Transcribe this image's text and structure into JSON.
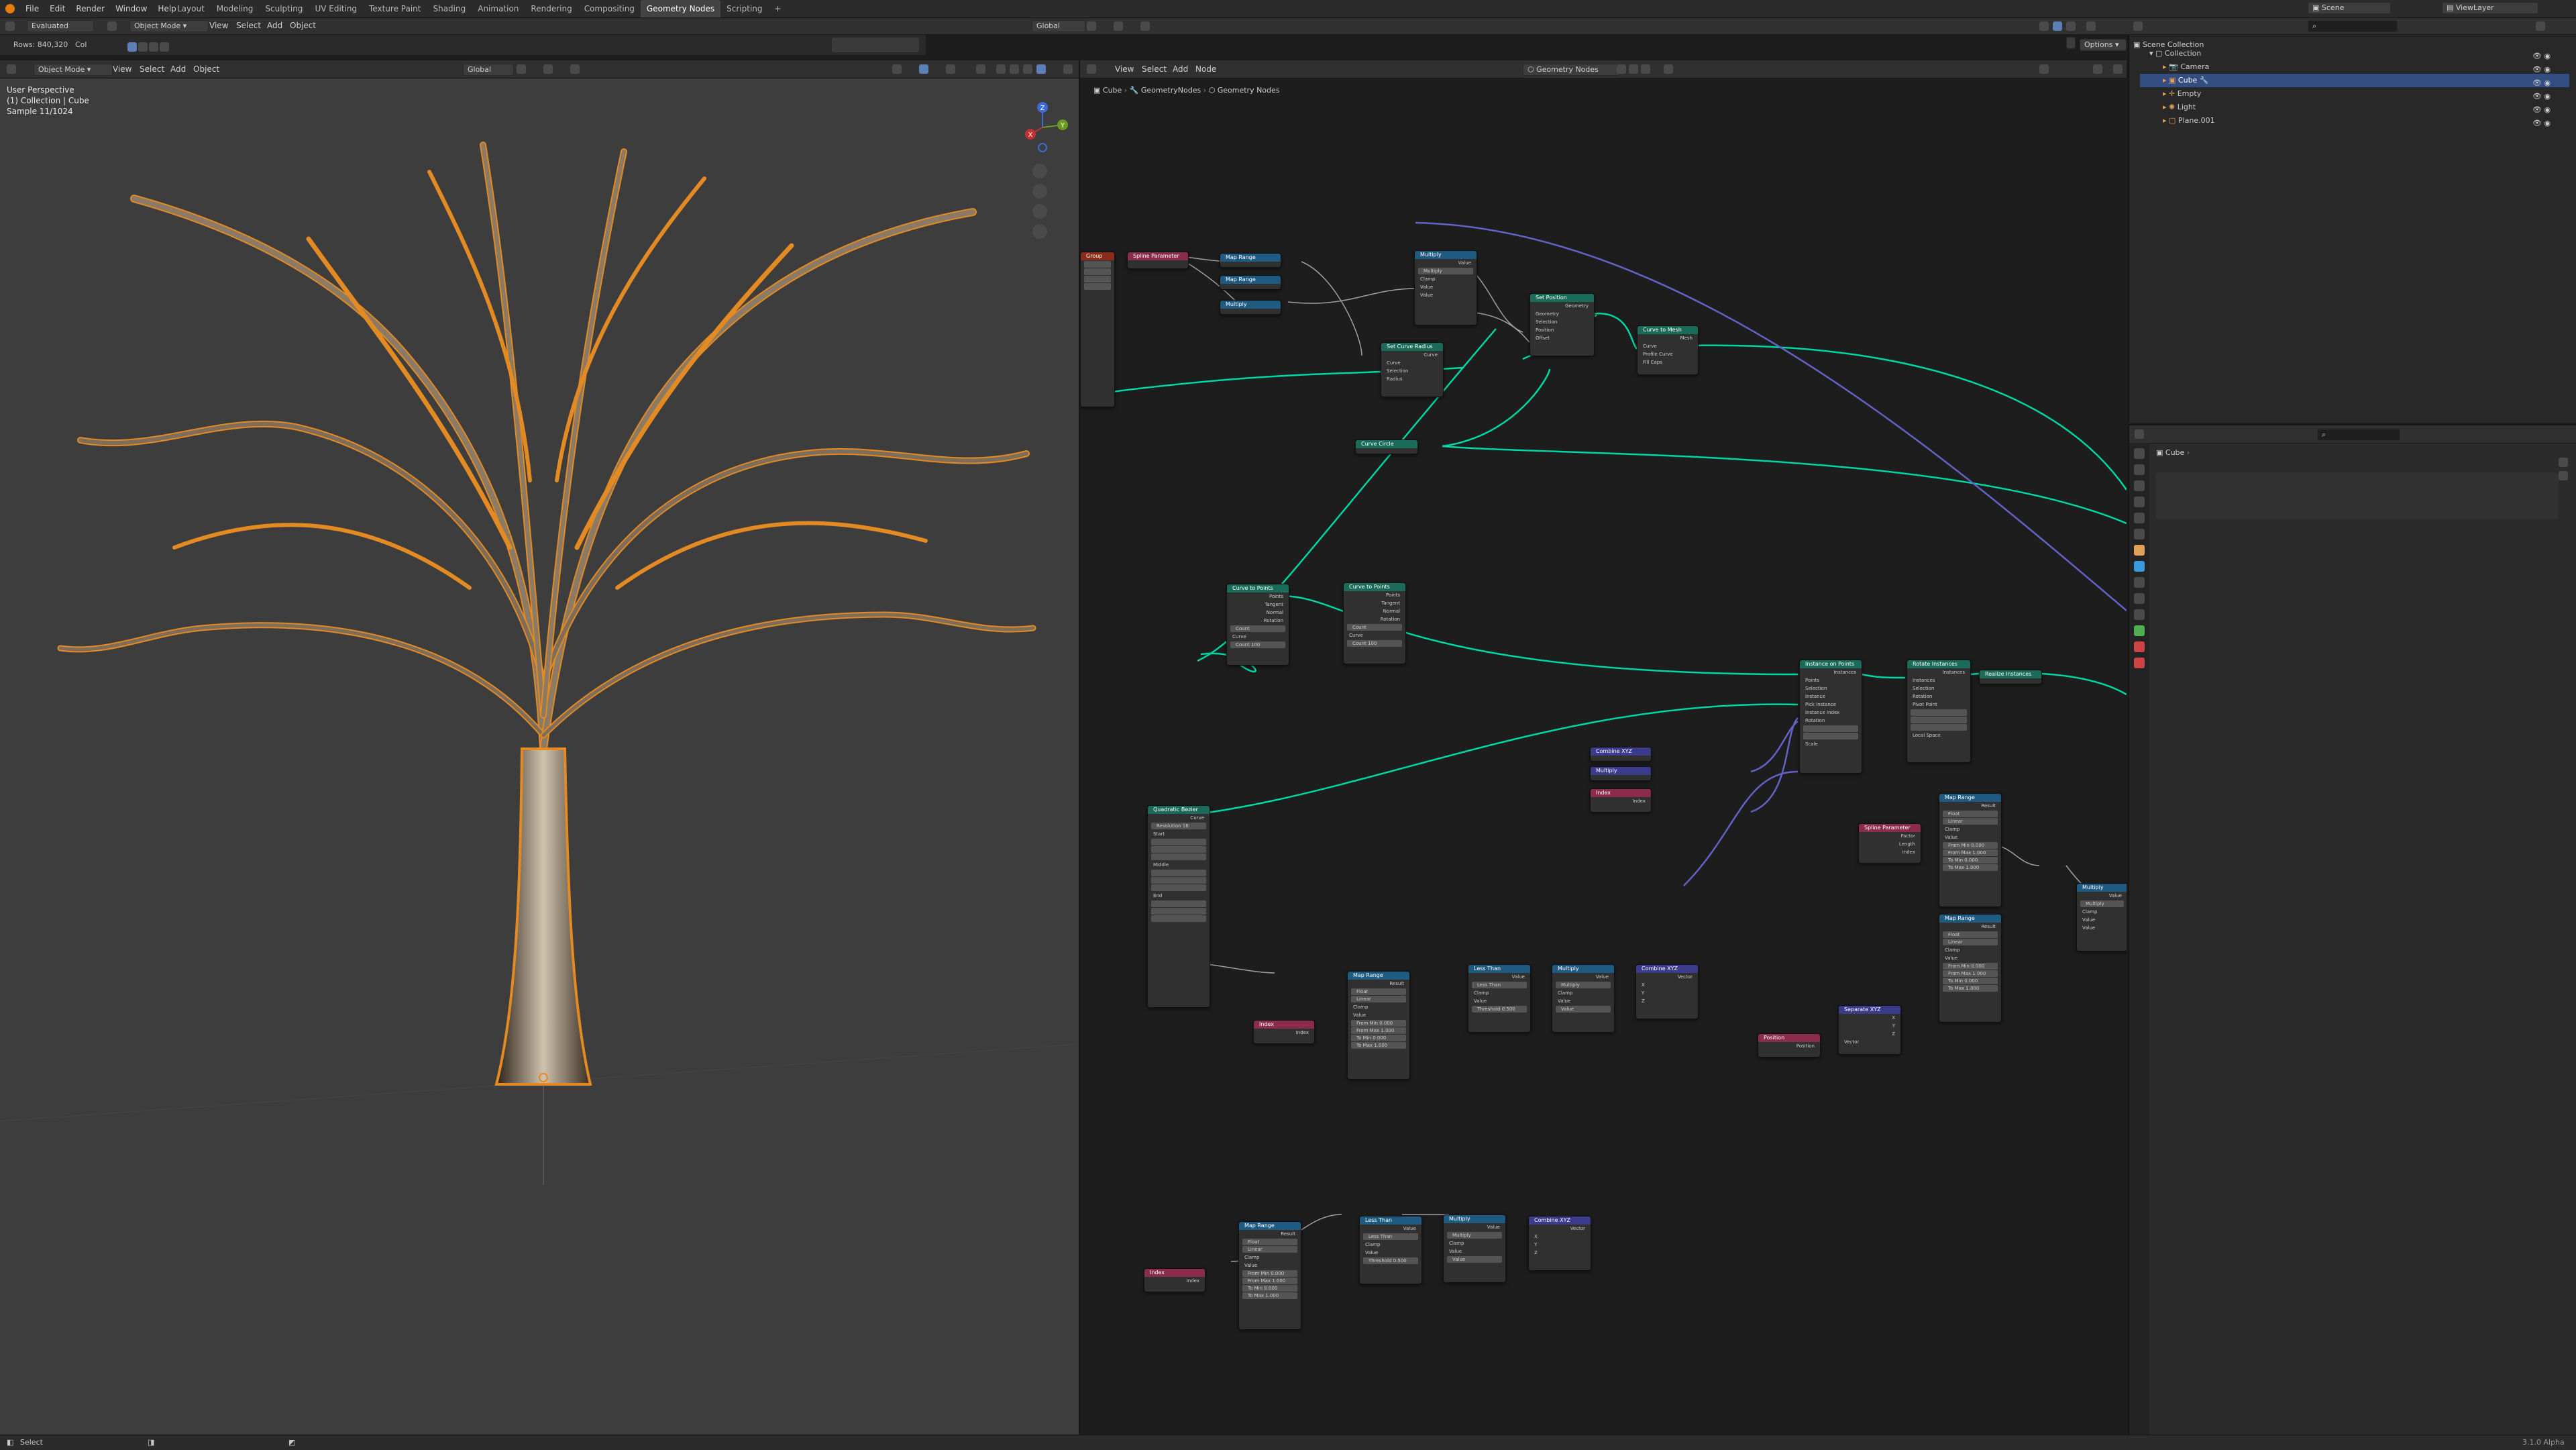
{
  "app": {
    "menu": [
      "File",
      "Edit",
      "Render",
      "Window",
      "Help"
    ],
    "workspaces": [
      "Layout",
      "Modeling",
      "Sculpting",
      "UV Editing",
      "Texture Paint",
      "Shading",
      "Animation",
      "Rendering",
      "Compositing",
      "Geometry Nodes",
      "Scripting"
    ],
    "active_workspace": "Geometry Nodes",
    "scene": "Scene",
    "view_layer": "ViewLayer",
    "global_transform": "Global",
    "options": "Options",
    "evaluated": "Evaluated",
    "rows": "Rows: 840,320",
    "col": "Col"
  },
  "viewport": {
    "mode": "Object Mode",
    "menu": [
      "View",
      "Select",
      "Add",
      "Object"
    ],
    "transform": "Global",
    "overlay_lines": [
      "User Perspective",
      "(1) Collection | Cube",
      "Sample 11/1024"
    ],
    "axes": {
      "x": "X",
      "y": "Y",
      "z": "Z"
    }
  },
  "node_editor": {
    "menu": [
      "View",
      "Select",
      "Add",
      "Node"
    ],
    "tree_name": "Geometry Nodes",
    "breadcrumb": [
      "Cube",
      "GeometryNodes",
      "Geometry Nodes"
    ]
  },
  "outliner": {
    "title": "Scene Collection",
    "items": [
      {
        "label": "Collection",
        "indent": 1,
        "selected": false
      },
      {
        "label": "Camera",
        "indent": 2,
        "selected": false
      },
      {
        "label": "Cube",
        "indent": 2,
        "selected": true
      },
      {
        "label": "Empty",
        "indent": 2,
        "selected": false
      },
      {
        "label": "Light",
        "indent": 2,
        "selected": false
      },
      {
        "label": "Plane.001",
        "indent": 2,
        "selected": false
      }
    ]
  },
  "properties": {
    "object": "Cube"
  },
  "statusbar": {
    "left": "Select",
    "right": "3.1.0 Alpha"
  },
  "colors": {
    "accent": "#e38a22",
    "selection": "#334d80",
    "geometry_link": "#00d6a3",
    "vector_link": "#6363c7"
  },
  "nodes": [
    {
      "title": "Spline Parameter",
      "color": "#8a2c4c",
      "rows": [
        "Factor",
        "Length",
        "Index"
      ]
    },
    {
      "title": "Map Range",
      "color": "#1f5a80",
      "rows": [
        "Result",
        "Float",
        "Linear",
        "Clamp",
        "Value",
        "From Min 0.000",
        "From Max 1.000",
        "To Min 0.000",
        "To Max 1.000"
      ]
    },
    {
      "title": "Multiply",
      "color": "#1f5a80",
      "rows": [
        "Value",
        "Multiply",
        "Clamp",
        "Value",
        "Value"
      ]
    },
    {
      "title": "Set Position",
      "color": "#1a6b59",
      "rows": [
        "Geometry",
        "Geometry",
        "Selection",
        "Position",
        "Offset"
      ]
    },
    {
      "title": "Curve to Mesh",
      "color": "#1a6b59",
      "rows": [
        "Mesh",
        "Curve",
        "Profile Curve",
        "Fill Caps"
      ]
    },
    {
      "title": "Set Curve Radius",
      "color": "#1a6b59",
      "rows": [
        "Curve",
        "Curve",
        "Selection",
        "Radius"
      ]
    },
    {
      "title": "Curve Circle",
      "color": "#1a6b59",
      "rows": [
        "Curve"
      ]
    },
    {
      "title": "Curve to Points",
      "color": "#1a6b59",
      "rows": [
        "Points",
        "Tangent",
        "Normal",
        "Rotation",
        "Count",
        "Curve",
        "Count 100"
      ]
    },
    {
      "title": "Instance on Points",
      "color": "#1a6b59",
      "rows": [
        "Instances",
        "Points",
        "Selection",
        "Instance",
        "Pick Instance",
        "Instance Index",
        "Rotation",
        "Scale"
      ]
    },
    {
      "title": "Rotate Instances",
      "color": "#1a6b59",
      "rows": [
        "Instances",
        "Instances",
        "Selection",
        "Rotation",
        "Pivot Point",
        "Local Space"
      ]
    },
    {
      "title": "Realize Instances",
      "color": "#1a6b59",
      "rows": [
        "Geometry"
      ]
    },
    {
      "title": "Combine XYZ",
      "color": "#3b3b8c",
      "rows": [
        "Vector"
      ]
    },
    {
      "title": "Position",
      "color": "#8a2c4c",
      "rows": [
        "Position"
      ]
    },
    {
      "title": "Index",
      "color": "#8a2c4c",
      "rows": [
        "Index"
      ]
    },
    {
      "title": "Quadratic Bezier",
      "color": "#1a6b59",
      "rows": [
        "Curve",
        "Resolution 16",
        "Start",
        "Middle",
        "End"
      ]
    },
    {
      "title": "Less Than",
      "color": "#1f5a80",
      "rows": [
        "Value",
        "Less Than",
        "Clamp",
        "Value",
        "Threshold 0.500"
      ]
    },
    {
      "title": "Separate XYZ",
      "color": "#3b3b8c",
      "rows": [
        "X",
        "Y",
        "Z",
        "Vector"
      ]
    },
    {
      "title": "Group Output",
      "color": "#8a2c1a",
      "rows": [
        "Geometry"
      ]
    }
  ]
}
